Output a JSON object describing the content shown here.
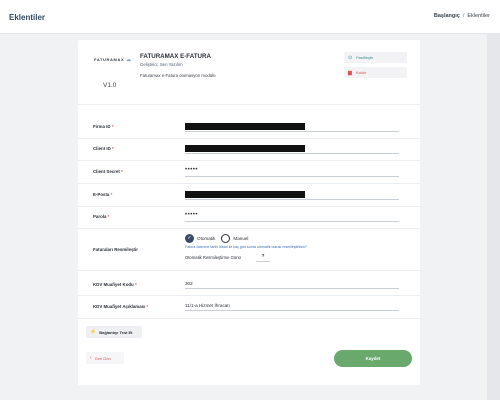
{
  "header": {
    "title": "Eklentiler",
    "breadcrumb": [
      "Başlangıç",
      "Eklentiler"
    ],
    "breadcrumb_separator": "/"
  },
  "plugin": {
    "logo_text": "FATURAMAX",
    "version": "V1.0",
    "name": "FATURAMAX E-FATURA",
    "developer": "Geliştirici: Sen Yazılım",
    "description": "Faturamax e-Fatura otomasyon modülü",
    "actions": {
      "passive_label": "Pasifleştir",
      "remove_label": "Kaldır"
    }
  },
  "form": {
    "firm_id": {
      "label": "Firma ID",
      "required": "*"
    },
    "client_id": {
      "label": "Client ID",
      "required": "*"
    },
    "client_secret": {
      "label": "Client Secret",
      "required": "*",
      "value": "•••••"
    },
    "email": {
      "label": "E-Posta",
      "required": "*"
    },
    "password": {
      "label": "Parola",
      "required": "*",
      "value": "•••••"
    },
    "invoice_finalize": {
      "label": "Faturaları Resmileştir",
      "options": [
        "Otomatik",
        "Manuel"
      ],
      "selected": "Otomatik",
      "help": "Fatura ödenme tarihi itibari ile kaç gün sonra otomatik olarak resmileştirilsin?",
      "auto_days_label": "Otomatik Resmileştirme Günü",
      "auto_days_value": "?"
    },
    "vat_exemption_code": {
      "label": "KDV Muafiyet Kodu",
      "required": "*",
      "value": "302"
    },
    "vat_exemption_desc": {
      "label": "KDV Muafiyet Açıklaması",
      "required": "*",
      "value": "11/1-a Hizmet İhracatı"
    }
  },
  "buttons": {
    "test_connection": "Bağlantıyı Test Et",
    "back": "Geri Dön",
    "save": "Kaydet"
  },
  "colors": {
    "accent": "#35495e",
    "danger": "#d9534f",
    "success": "#6aa96c",
    "link": "#3c6fae"
  }
}
